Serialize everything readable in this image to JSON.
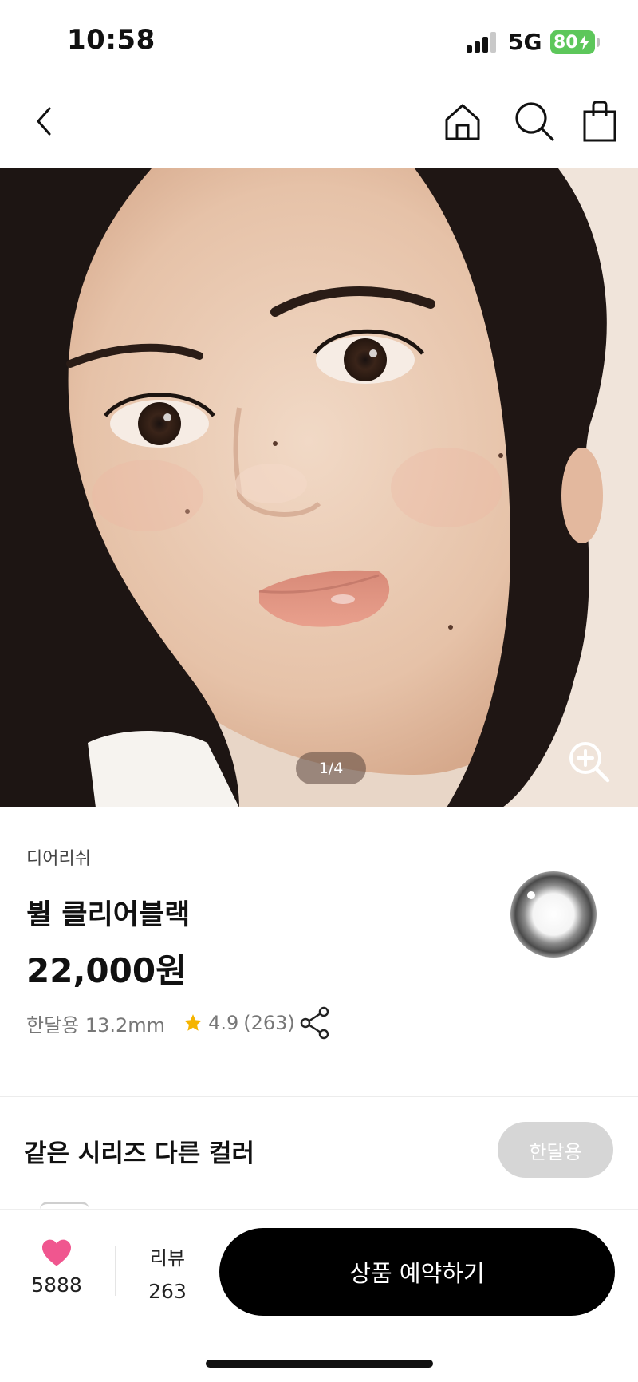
{
  "status_bar": {
    "time": "10:58",
    "network": "5G",
    "battery": "80"
  },
  "nav": {
    "back_icon": "chevron-left-icon",
    "home_icon": "home-icon",
    "search_icon": "search-icon",
    "bag_icon": "shopping-bag-icon"
  },
  "gallery": {
    "indicator": "1/4",
    "zoom_icon": "zoom-in-icon"
  },
  "product": {
    "brand": "디어리쉬",
    "name": "뷜 클리어블랙",
    "price": "22,000원",
    "spec": "한달용 13.2mm",
    "rating": "4.9",
    "review_count_paren": "(263)",
    "share_icon": "share-icon"
  },
  "series": {
    "title": "같은 시리즈 다른 컬러",
    "filter_label": "한달용"
  },
  "bottom_bar": {
    "like_count": "5888",
    "review_label": "리뷰",
    "review_count": "263",
    "cta_label": "상품 예약하기"
  },
  "colors": {
    "cta": "#000000",
    "heart": "#f0568f",
    "star": "#f5b400",
    "battery": "#5dc75b"
  }
}
